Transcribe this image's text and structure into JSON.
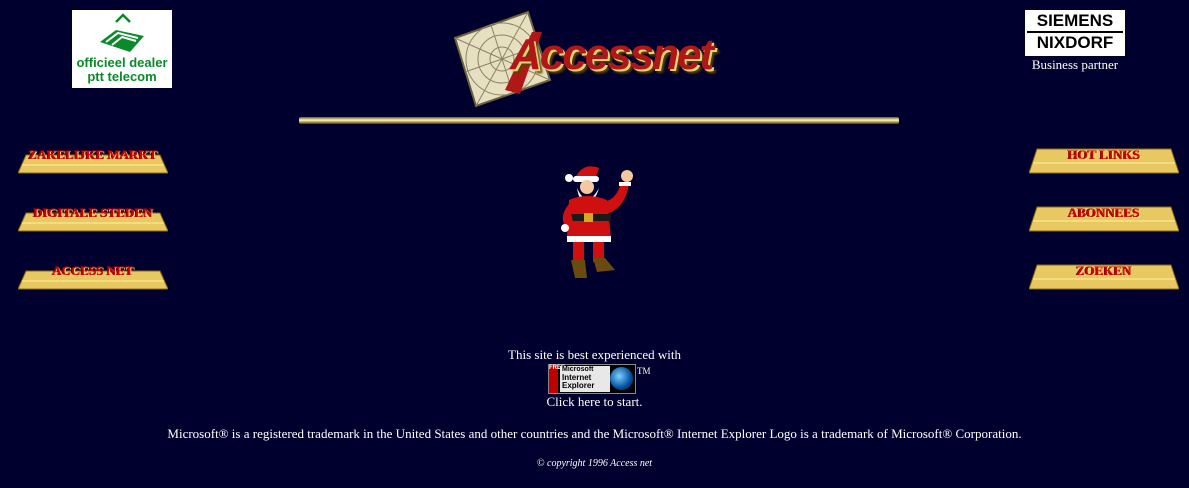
{
  "partners": {
    "ptt_line1": "officieel dealer",
    "ptt_line2": "ptt telecom",
    "siemens_line1": "SIEMENS",
    "siemens_line2": "NIXDORF",
    "business_partner": "Business partner"
  },
  "logo": {
    "text": "Accessnet"
  },
  "nav_left": [
    {
      "label": "ZAKELIJKE MARKT"
    },
    {
      "label": "DIGITALE STEDEN"
    },
    {
      "label": "ACCESS NET"
    }
  ],
  "nav_right": [
    {
      "label": "HOT LINKS"
    },
    {
      "label": "ABONNEES"
    },
    {
      "label": "ZOEKEN"
    }
  ],
  "browser": {
    "best_experienced": "This site is best experienced with",
    "badge_free": "FREE",
    "badge_line1": "Microsoft",
    "badge_line2": "Internet",
    "badge_line3": "Explorer",
    "tm": "TM",
    "click_here": "Click here to start."
  },
  "trademark_notice": "Microsoft® is a registered trademark in the United States and other countries and the Microsoft® Internet Explorer Logo is a trademark of Microsoft® Corporation.",
  "copyright": "© copyright 1996 Access net",
  "colors": {
    "background": "#00002e",
    "nav_label": "#d20000",
    "nav_gold": "#e8c860"
  }
}
